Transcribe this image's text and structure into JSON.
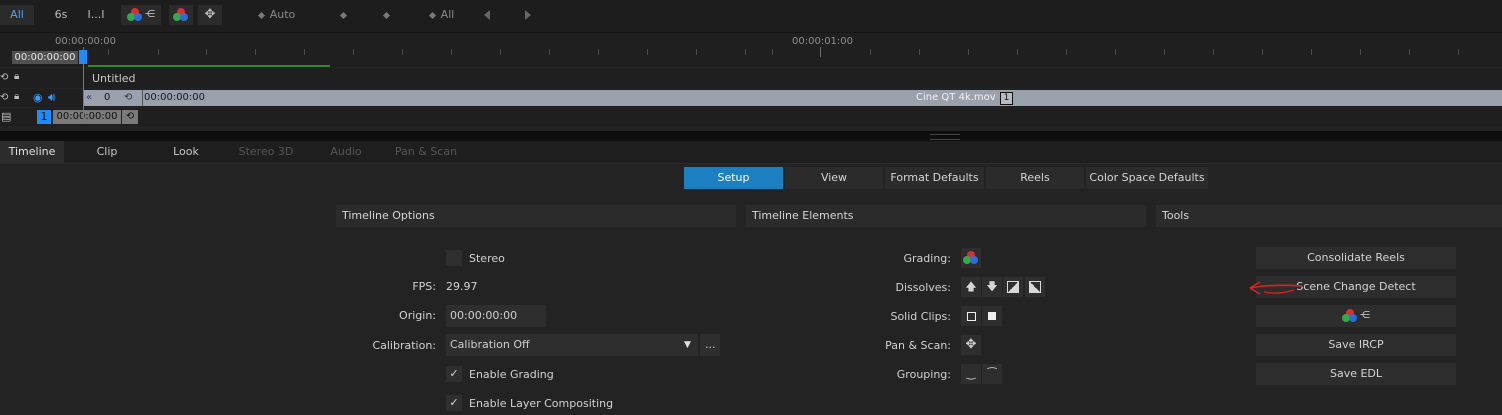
{
  "toolbar": {
    "filter_all": "All",
    "duration": "6s",
    "marker": "I...I",
    "keyframe_auto": "Auto",
    "keyframe_all": "All"
  },
  "ruler": {
    "tc_start": "00:00:00:00",
    "tc_one_sec": "00:00:01:00",
    "playhead_tc": "00:00:00:00"
  },
  "tracks": {
    "group_name": "Untitled",
    "clip_offset": "0",
    "clip_tc": "00:00:00:00",
    "clip_name": "Cine QT 4k.mov",
    "clip_badge": "1",
    "video_track_num": "1",
    "video_track_tc": "00:00:00:00"
  },
  "main_tabs": [
    "Timeline",
    "Clip",
    "Look",
    "Stereo 3D",
    "Audio",
    "Pan & Scan"
  ],
  "sub_tabs": [
    "Setup",
    "View",
    "Format Defaults",
    "Reels",
    "Color Space Defaults"
  ],
  "timeline_options": {
    "header": "Timeline Options",
    "stereo_label": "Stereo",
    "fps_label": "FPS:",
    "fps_value": "29.97",
    "origin_label": "Origin:",
    "origin_value": "00:00:00:00",
    "calibration_label": "Calibration:",
    "calibration_value": "Calibration Off",
    "calibration_more": "...",
    "enable_grading": "Enable Grading",
    "enable_layer_compositing": "Enable Layer Compositing"
  },
  "timeline_elements": {
    "header": "Timeline Elements",
    "grading_label": "Grading:",
    "dissolves_label": "Dissolves:",
    "solid_clips_label": "Solid Clips:",
    "pan_scan_label": "Pan & Scan:",
    "grouping_label": "Grouping:"
  },
  "tools": {
    "header": "Tools",
    "consolidate_reels": "Consolidate Reels",
    "scene_change_detect": "Scene Change Detect",
    "save_ircp": "Save IRCP",
    "save_edl": "Save EDL"
  },
  "colors": {
    "accent_blue": "#1b7fc2",
    "playhead_blue": "#1e8cff",
    "annotation_red": "#e0201f"
  }
}
